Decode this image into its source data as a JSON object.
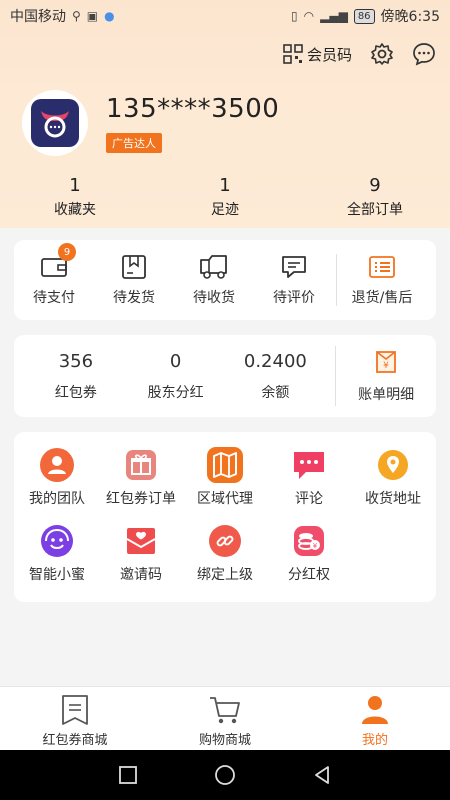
{
  "status_bar": {
    "carrier": "中国移动",
    "time": "傍晚6:35",
    "battery": "86"
  },
  "top_actions": {
    "member_code_label": "会员码"
  },
  "profile": {
    "username": "135****3500",
    "badge": "广告达人"
  },
  "stats": [
    {
      "value": "1",
      "label": "收藏夹"
    },
    {
      "value": "1",
      "label": "足迹"
    },
    {
      "value": "9",
      "label": "全部订单"
    }
  ],
  "orders": {
    "items": [
      {
        "label": "待支付",
        "badge": "9"
      },
      {
        "label": "待发货"
      },
      {
        "label": "待收货"
      },
      {
        "label": "待评价"
      }
    ],
    "refund_label": "退货/售后"
  },
  "wallet": {
    "items": [
      {
        "value": "356",
        "label": "红包券"
      },
      {
        "value": "0",
        "label": "股东分红"
      },
      {
        "value": "0.2400",
        "label": "余额"
      }
    ],
    "bill_label": "账单明细"
  },
  "tools": [
    {
      "label": "我的团队",
      "icon": "team-icon",
      "color": "#f2683a"
    },
    {
      "label": "红包券订单",
      "icon": "gift-icon",
      "color": "#e8857f"
    },
    {
      "label": "区域代理",
      "icon": "map-icon",
      "color": "#f2731e"
    },
    {
      "label": "评论",
      "icon": "comment-icon",
      "color": "#ef3f62"
    },
    {
      "label": "收货地址",
      "icon": "location-icon",
      "color": "#f5a623"
    },
    {
      "label": "智能小蜜",
      "icon": "assistant-icon",
      "color": "#7b3fe4"
    },
    {
      "label": "邀请码",
      "icon": "envelope-icon",
      "color": "#ef4d4d"
    },
    {
      "label": "绑定上级",
      "icon": "link-icon",
      "color": "#ef5a4a"
    },
    {
      "label": "分红权",
      "icon": "coins-icon",
      "color": "#ef4d6a"
    }
  ],
  "tabbar": [
    {
      "label": "红包券商城",
      "icon": "coupon-mall-icon"
    },
    {
      "label": "购物商城",
      "icon": "cart-icon"
    },
    {
      "label": "我的",
      "icon": "profile-icon",
      "active": true
    }
  ],
  "colors": {
    "accent": "#f2731e",
    "header_bg": "#fde9d4"
  }
}
